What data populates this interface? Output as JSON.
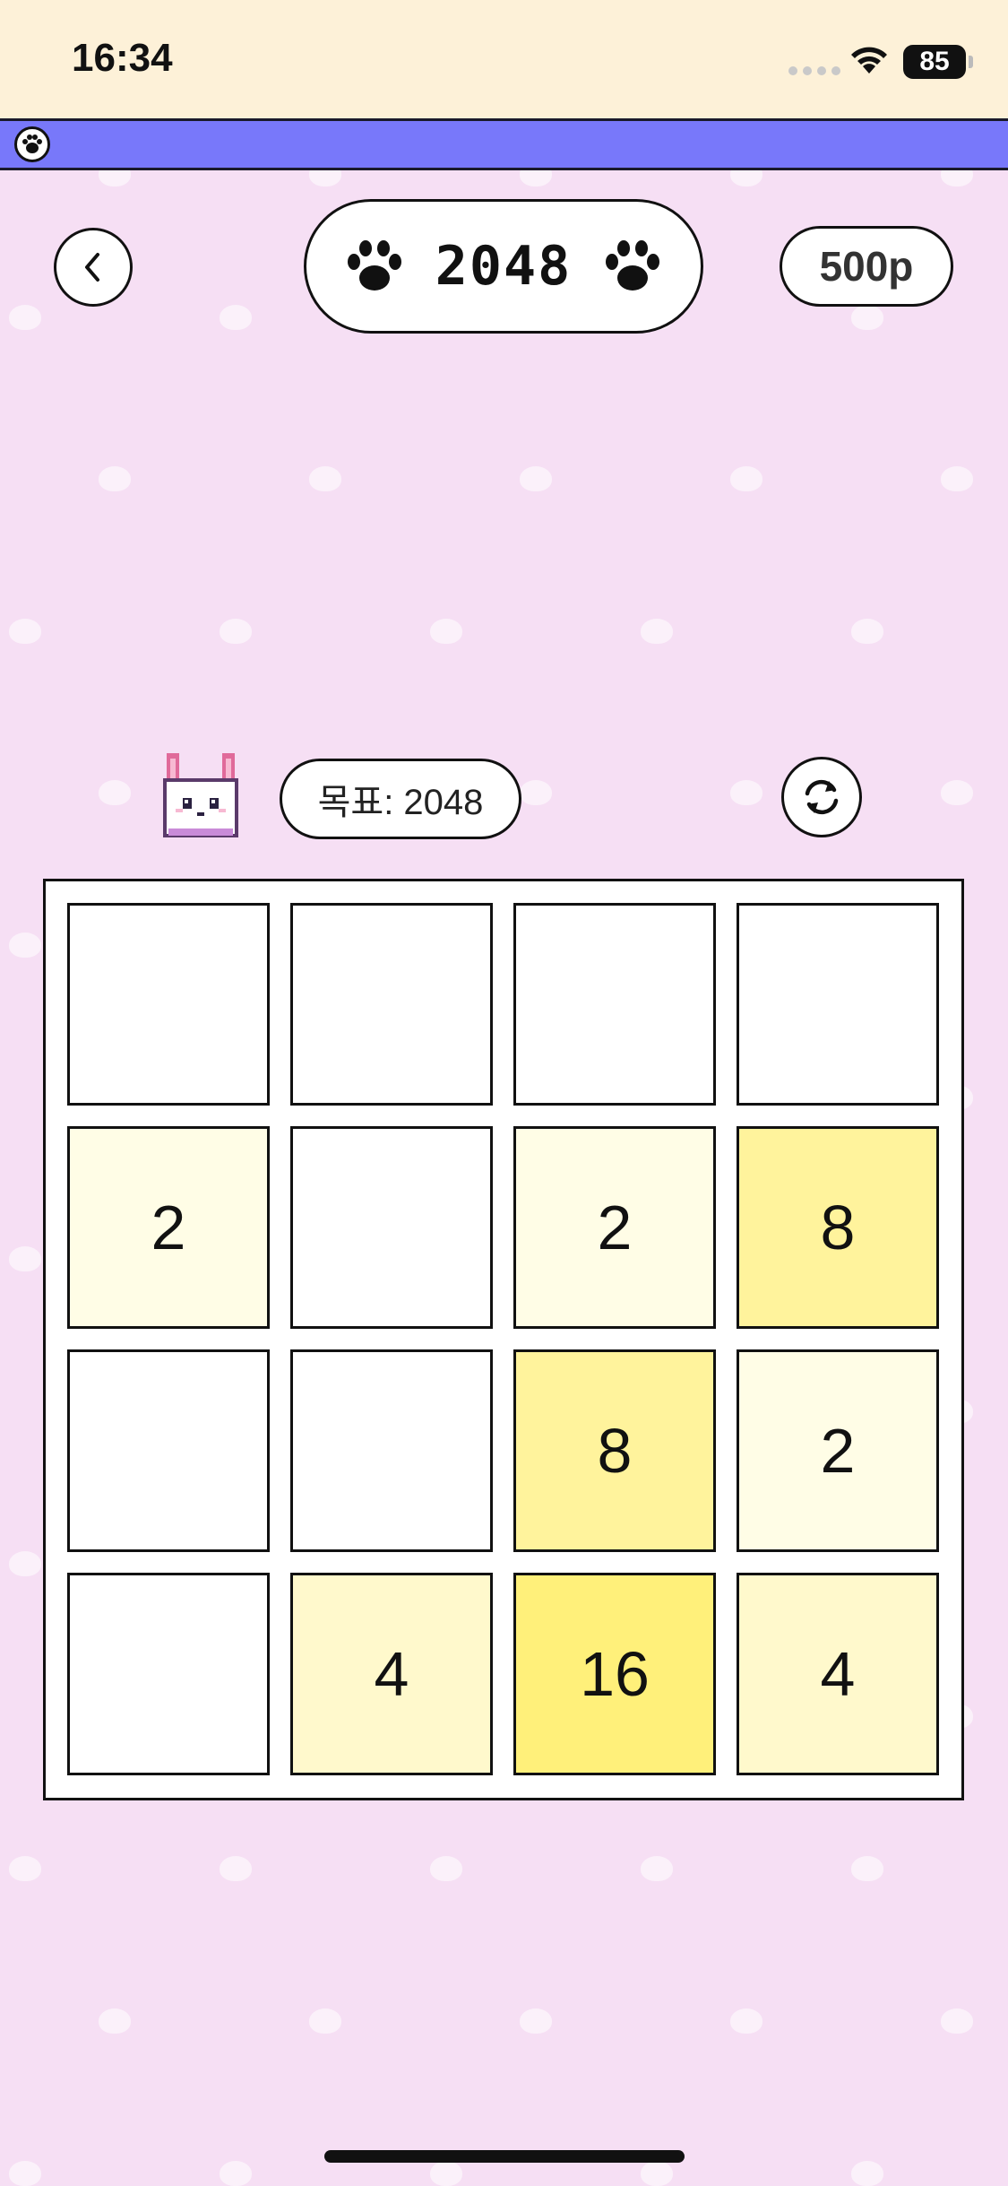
{
  "status_bar": {
    "time": "16:34",
    "battery": "85"
  },
  "header": {
    "back_icon": "chevron-left-icon",
    "title": "2048",
    "title_icons": [
      "paw-icon",
      "paw-icon"
    ],
    "points": "500p"
  },
  "goal": {
    "label": "목표: 2048",
    "reset_icon": "refresh-icon"
  },
  "board": {
    "rows": [
      [
        "",
        "",
        "",
        ""
      ],
      [
        "2",
        "",
        "2",
        "8"
      ],
      [
        "",
        "",
        "8",
        "2"
      ],
      [
        "",
        "4",
        "16",
        "4"
      ]
    ]
  },
  "tile_colors": {
    "empty": "#ffffff",
    "2": "#fffde6",
    "4": "#fff9cc",
    "8": "#fff39c",
    "16": "#fff07a"
  },
  "colors": {
    "background": "#f6dff4",
    "status_bar": "#fdf1d8",
    "banner": "#7878fa"
  }
}
